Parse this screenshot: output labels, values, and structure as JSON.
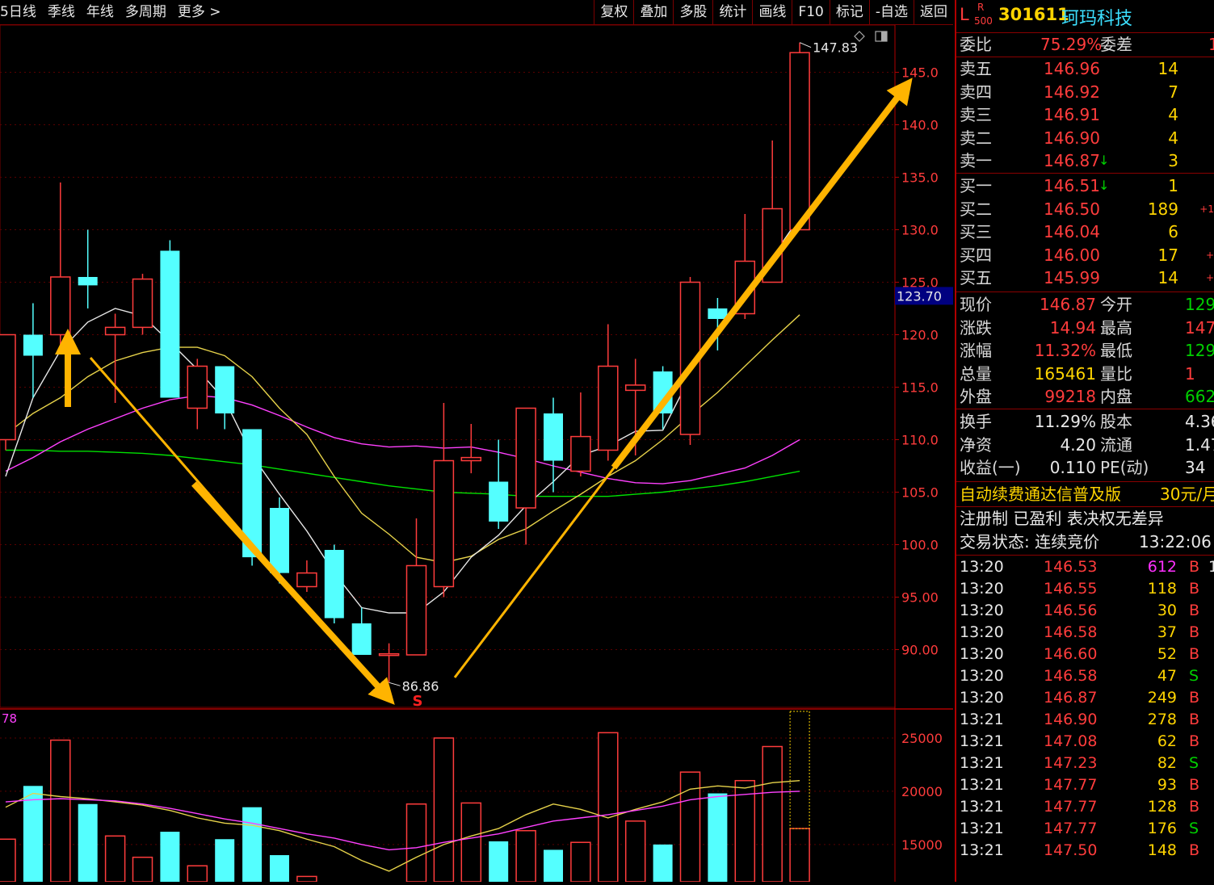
{
  "toolbar": {
    "period_tabs": [
      "5日线",
      "季线",
      "年线",
      "多周期",
      "更多 >"
    ],
    "buttons": [
      "复权",
      "叠加",
      "多股",
      "统计",
      "画线",
      "F10",
      "标记",
      "-自选",
      "返回"
    ]
  },
  "stock": {
    "prefix": "L",
    "badge_top": "R",
    "badge_bottom": "500",
    "code": "301611",
    "name": "珂玛科技"
  },
  "order_ratio": {
    "label": "委比",
    "value": "75.29%",
    "label2": "委差",
    "value2": "1"
  },
  "asks": [
    {
      "label": "卖五",
      "price": "146.96",
      "vol": "14"
    },
    {
      "label": "卖四",
      "price": "146.92",
      "vol": "7"
    },
    {
      "label": "卖三",
      "price": "146.91",
      "vol": "4"
    },
    {
      "label": "卖二",
      "price": "146.90",
      "vol": "4"
    },
    {
      "label": "卖一",
      "price": "146.87",
      "vol": "3",
      "arrow": "↓"
    }
  ],
  "bids": [
    {
      "label": "买一",
      "price": "146.51",
      "vol": "1",
      "arrow": "↓"
    },
    {
      "label": "买二",
      "price": "146.50",
      "vol": "189",
      "extra": "+1"
    },
    {
      "label": "买三",
      "price": "146.04",
      "vol": "6"
    },
    {
      "label": "买四",
      "price": "146.00",
      "vol": "17",
      "extra": "+"
    },
    {
      "label": "买五",
      "price": "145.99",
      "vol": "14",
      "extra": "+"
    }
  ],
  "quote": [
    {
      "l1": "现价",
      "v1": "146.87",
      "c1": "red",
      "l2": "今开",
      "v2": "129",
      "c2": "grn"
    },
    {
      "l1": "涨跌",
      "v1": "14.94",
      "c1": "red",
      "l2": "最高",
      "v2": "147",
      "c2": "red"
    },
    {
      "l1": "涨幅",
      "v1": "11.32%",
      "c1": "red",
      "l2": "最低",
      "v2": "129",
      "c2": "grn"
    },
    {
      "l1": "总量",
      "v1": "165461",
      "c1": "yel",
      "l2": "量比",
      "v2": "1",
      "c2": "red"
    },
    {
      "l1": "外盘",
      "v1": "99218",
      "c1": "red",
      "l2": "内盘",
      "v2": "662",
      "c2": "grn"
    }
  ],
  "fundamentals": [
    {
      "l1": "换手",
      "v1": "11.29%",
      "l2": "股本",
      "v2": "4.36"
    },
    {
      "l1": "净资",
      "v1": "4.20",
      "l2": "流通",
      "v2": "1.47"
    },
    {
      "l1": "收益(一)",
      "v1": "0.110",
      "l2": "PE(动)",
      "v2": "34"
    }
  ],
  "ad_line": {
    "text": "自动续费通达信普及版",
    "price": "30元/月"
  },
  "tags_line": "注册制 已盈利 表决权无差异",
  "status_line": {
    "label": "交易状态: 连续竞价",
    "time": "13:22:06"
  },
  "ticks": [
    {
      "t": "13:20",
      "p": "146.53",
      "v": "612",
      "vc": "mag",
      "s": "B",
      "x": "1"
    },
    {
      "t": "13:20",
      "p": "146.55",
      "v": "118",
      "vc": "yel",
      "s": "B"
    },
    {
      "t": "13:20",
      "p": "146.56",
      "v": "30",
      "vc": "yel",
      "s": "B"
    },
    {
      "t": "13:20",
      "p": "146.58",
      "v": "37",
      "vc": "yel",
      "s": "B"
    },
    {
      "t": "13:20",
      "p": "146.60",
      "v": "52",
      "vc": "yel",
      "s": "B"
    },
    {
      "t": "13:20",
      "p": "146.58",
      "v": "47",
      "vc": "yel",
      "s": "S"
    },
    {
      "t": "13:20",
      "p": "146.87",
      "v": "249",
      "vc": "yel",
      "s": "B"
    },
    {
      "t": "13:21",
      "p": "146.90",
      "v": "278",
      "vc": "yel",
      "s": "B"
    },
    {
      "t": "13:21",
      "p": "147.08",
      "v": "62",
      "vc": "yel",
      "s": "B"
    },
    {
      "t": "13:21",
      "p": "147.23",
      "v": "82",
      "vc": "yel",
      "s": "S"
    },
    {
      "t": "13:21",
      "p": "147.77",
      "v": "93",
      "vc": "yel",
      "s": "B"
    },
    {
      "t": "13:21",
      "p": "147.77",
      "v": "128",
      "vc": "yel",
      "s": "B"
    },
    {
      "t": "13:21",
      "p": "147.77",
      "v": "176",
      "vc": "yel",
      "s": "S"
    },
    {
      "t": "13:21",
      "p": "147.50",
      "v": "148",
      "vc": "yel",
      "s": "B"
    }
  ],
  "chart": {
    "price_axis": [
      "145.0",
      "140.0",
      "135.0",
      "130.0",
      "125.0",
      "120.0",
      "115.0",
      "110.0",
      "105.0",
      "100.0",
      "95.00",
      "90.00"
    ],
    "current_price_tag": "123.70",
    "high_label": "147.83",
    "low_label": "86.86",
    "signal_mark": "S",
    "volume_indicator_label": "78",
    "volume_axis": [
      "25000",
      "20000",
      "15000"
    ]
  },
  "chart_data": {
    "type": "candlestick",
    "ylim": [
      84.5,
      149.5
    ],
    "colors": {
      "up": "#ff3c3c",
      "down": "#54ffff",
      "ma5": "#e8e8e8",
      "ma10": "#e6d24a",
      "ma20": "#ff40ff",
      "ma60": "#00e000"
    },
    "candles": [
      {
        "o": 110.0,
        "c": 120.0,
        "h": 120.0,
        "l": 109.0,
        "v": 15500
      },
      {
        "o": 120.0,
        "c": 118.0,
        "h": 123.0,
        "l": 114.0,
        "v": 20500
      },
      {
        "o": 120.0,
        "c": 125.5,
        "h": 134.5,
        "l": 119.0,
        "v": 24800
      },
      {
        "o": 125.5,
        "c": 124.7,
        "h": 130.0,
        "l": 122.5,
        "v": 18800
      },
      {
        "o": 120.0,
        "c": 120.7,
        "h": 122.0,
        "l": 113.5,
        "v": 15800
      },
      {
        "o": 120.7,
        "c": 125.3,
        "h": 125.8,
        "l": 120.0,
        "v": 13800
      },
      {
        "o": 128.0,
        "c": 114.0,
        "h": 129.0,
        "l": 114.0,
        "v": 16200
      },
      {
        "o": 113.0,
        "c": 117.0,
        "h": 117.7,
        "l": 111.0,
        "v": 13000
      },
      {
        "o": 117.0,
        "c": 112.5,
        "h": 117.0,
        "l": 111.0,
        "v": 15500
      },
      {
        "o": 111.0,
        "c": 98.8,
        "h": 111.0,
        "l": 98.0,
        "v": 18500
      },
      {
        "o": 103.5,
        "c": 97.3,
        "h": 104.5,
        "l": 96.3,
        "v": 14000
      },
      {
        "o": 96.0,
        "c": 97.3,
        "h": 98.5,
        "l": 95.5,
        "v": 12000
      },
      {
        "o": 99.5,
        "c": 93.0,
        "h": 100.0,
        "l": 92.5,
        "v": 11500
      },
      {
        "o": 92.5,
        "c": 89.5,
        "h": 94.0,
        "l": 89.5,
        "v": 9000
      },
      {
        "o": 89.5,
        "c": 89.6,
        "h": 90.6,
        "l": 86.86,
        "v": 9200
      },
      {
        "o": 89.5,
        "c": 98.0,
        "h": 102.5,
        "l": 89.5,
        "v": 18800
      },
      {
        "o": 96.0,
        "c": 108.0,
        "h": 113.5,
        "l": 95.0,
        "v": 25000
      },
      {
        "o": 108.0,
        "c": 108.3,
        "h": 111.5,
        "l": 106.8,
        "v": 18900
      },
      {
        "o": 106.0,
        "c": 102.2,
        "h": 110.0,
        "l": 101.5,
        "v": 15300
      },
      {
        "o": 103.5,
        "c": 113.0,
        "h": 113.0,
        "l": 100.0,
        "v": 16300
      },
      {
        "o": 112.5,
        "c": 108.0,
        "h": 114.0,
        "l": 105.0,
        "v": 14500
      },
      {
        "o": 107.0,
        "c": 110.3,
        "h": 114.5,
        "l": 106.5,
        "v": 15200
      },
      {
        "o": 109.0,
        "c": 117.0,
        "h": 121.0,
        "l": 108.0,
        "v": 25500
      },
      {
        "o": 114.7,
        "c": 115.2,
        "h": 117.7,
        "l": 108.5,
        "v": 17200
      },
      {
        "o": 116.5,
        "c": 112.5,
        "h": 117.0,
        "l": 111.0,
        "v": 15000
      },
      {
        "o": 110.5,
        "c": 125.0,
        "h": 125.5,
        "l": 109.5,
        "v": 21800
      },
      {
        "o": 122.5,
        "c": 121.5,
        "h": 123.5,
        "l": 118.5,
        "v": 19800
      },
      {
        "o": 122.0,
        "c": 127.0,
        "h": 131.5,
        "l": 121.5,
        "v": 21000
      },
      {
        "o": 125.0,
        "c": 132.0,
        "h": 138.5,
        "l": 125.0,
        "v": 24200
      },
      {
        "o": 130.0,
        "c": 146.87,
        "h": 147.83,
        "l": 130.0,
        "v": 16500
      }
    ],
    "ma5": [
      106.5,
      114.0,
      118.5,
      121.2,
      122.5,
      121.8,
      119.3,
      116.7,
      113.8,
      108.5,
      104.8,
      101.3,
      97.3,
      94.0,
      93.5,
      93.5,
      95.5,
      98.8,
      100.9,
      103.7,
      106.0,
      108.5,
      109.4,
      110.8,
      110.9,
      116.0,
      120.5,
      124.1,
      127.4,
      131.2
    ],
    "ma10": [
      110.5,
      112.5,
      114.0,
      116.0,
      117.5,
      118.3,
      118.8,
      118.8,
      118.0,
      116.0,
      113.0,
      110.5,
      106.5,
      103.0,
      101.0,
      98.8,
      98.3,
      98.9,
      100.5,
      101.5,
      103.2,
      104.8,
      106.5,
      108.0,
      110.0,
      112.3,
      114.5,
      117.0,
      119.5,
      121.9
    ],
    "ma20": [
      107.0,
      108.3,
      109.8,
      111.0,
      112.0,
      113.0,
      113.8,
      114.2,
      114.0,
      113.3,
      112.3,
      111.2,
      110.2,
      109.6,
      109.3,
      109.4,
      109.2,
      109.3,
      108.8,
      108.2,
      107.5,
      106.9,
      106.3,
      105.9,
      105.8,
      106.1,
      106.7,
      107.3,
      108.5,
      110.0
    ],
    "ma60": [
      109.0,
      109.0,
      108.9,
      108.9,
      108.8,
      108.7,
      108.5,
      108.2,
      107.9,
      107.6,
      107.2,
      106.8,
      106.4,
      106.0,
      105.6,
      105.3,
      105.0,
      104.9,
      104.8,
      104.6,
      104.6,
      104.6,
      104.6,
      104.8,
      105.0,
      105.3,
      105.6,
      106.0,
      106.5,
      107.0
    ],
    "vol_ma1": [
      18500,
      19800,
      19500,
      19300,
      19000,
      18700,
      18200,
      17500,
      17000,
      16800,
      16300,
      15500,
      14800,
      13500,
      12500,
      13800,
      15000,
      15800,
      16500,
      17800,
      18800,
      18300,
      17500,
      18300,
      19000,
      20200,
      20500,
      20300,
      20800,
      21000
    ],
    "vol_ma2": [
      19000,
      19200,
      19300,
      19200,
      19100,
      18800,
      18400,
      17900,
      17400,
      17000,
      16500,
      16000,
      15600,
      15000,
      14500,
      14700,
      15200,
      15600,
      16000,
      16600,
      17200,
      17500,
      17800,
      18200,
      18600,
      19200,
      19500,
      19700,
      19900,
      20000
    ],
    "vol_ylim": [
      11500,
      27500
    ]
  }
}
